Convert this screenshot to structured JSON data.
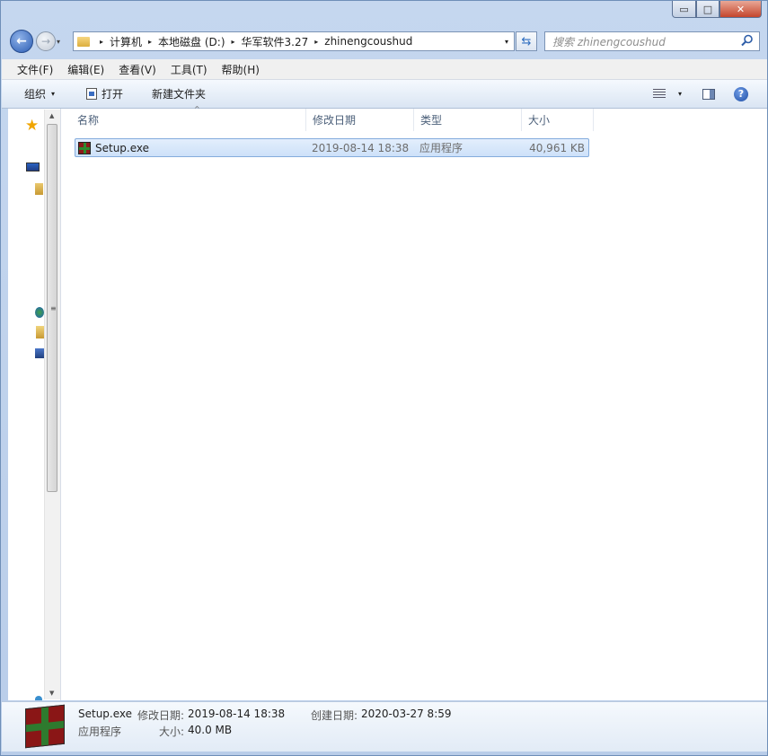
{
  "window": {
    "controls": {
      "minimize": "▭",
      "maximize": "□",
      "close": "✕"
    }
  },
  "address": {
    "back_label": "←",
    "forward_label": "→",
    "history_label": "▾",
    "crumbs": [
      "计算机",
      "本地磁盘 (D:)",
      "华军软件3.27",
      "zhinengcoushud"
    ],
    "sep": "▸",
    "dropdown": "▾",
    "refresh_label": "⇆",
    "search_placeholder": "搜索 zhinengcoushud"
  },
  "menubar": {
    "items": [
      "文件(F)",
      "编辑(E)",
      "查看(V)",
      "工具(T)",
      "帮助(H)"
    ]
  },
  "toolbar": {
    "organize": "组织",
    "organize_arrow": "▾",
    "open": "打开",
    "new_folder": "新建文件夹",
    "views_arrow": "▾",
    "help_label": "?"
  },
  "nav_scroll": {
    "up": "▲",
    "down": "▼",
    "grip": "≡"
  },
  "nav_star": "★",
  "columns": {
    "name": "名称",
    "modified": "修改日期",
    "type": "类型",
    "size": "大小",
    "sort_arrow": "^"
  },
  "files": [
    {
      "name": "Setup.exe",
      "modified": "2019-08-14 18:38",
      "type": "应用程序",
      "size": "40,961 KB"
    }
  ],
  "details": {
    "filename": "Setup.exe",
    "modified_label": "修改日期:",
    "modified_value": "2019-08-14 18:38",
    "created_label": "创建日期:",
    "created_value": "2020-03-27 8:59",
    "type": "应用程序",
    "size_label": "大小:",
    "size_value": "40.0 MB"
  }
}
